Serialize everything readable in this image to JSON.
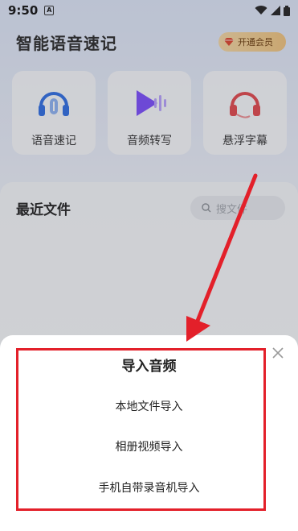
{
  "status_bar": {
    "time": "9:50",
    "notification_glyph": "A"
  },
  "header": {
    "app_title": "智能语音速记",
    "vip_button_label": "开通会员"
  },
  "features": [
    {
      "label": "语音速记",
      "icon": "headphones-mic-icon"
    },
    {
      "label": "音频转写",
      "icon": "audio-play-icon"
    },
    {
      "label": "悬浮字幕",
      "icon": "headset-icon"
    }
  ],
  "recent": {
    "title": "最近文件",
    "search_placeholder": "搜文件"
  },
  "import_sheet": {
    "title": "导入音频",
    "options": [
      "本地文件导入",
      "相册视频导入",
      "手机自带录音机导入"
    ]
  },
  "colors": {
    "highlight": "#e3202a",
    "vip_gold": "#f2c57e",
    "accent_blue": "#3b82f6",
    "accent_purple": "#7c4dff"
  }
}
